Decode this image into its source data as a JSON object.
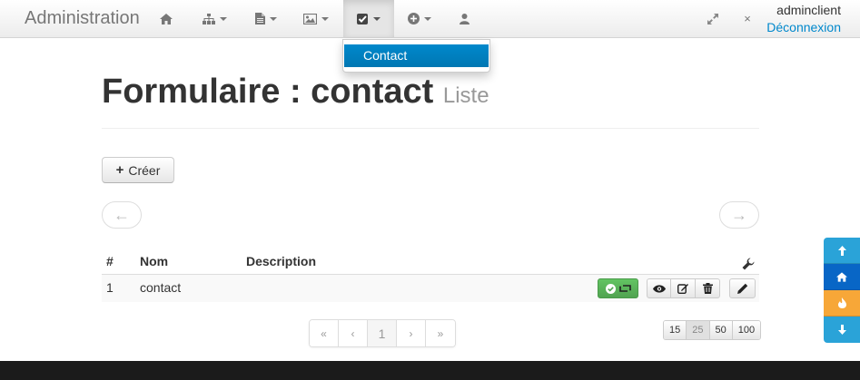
{
  "navbar": {
    "brand": "Administration",
    "items": [
      {
        "icon": "home-icon"
      },
      {
        "icon": "sitemap-icon",
        "dropdown": true
      },
      {
        "icon": "file-icon",
        "dropdown": true
      },
      {
        "icon": "picture-icon",
        "dropdown": true
      },
      {
        "icon": "check-icon",
        "dropdown": true,
        "active": true
      },
      {
        "icon": "plus-circle-icon",
        "dropdown": true
      },
      {
        "icon": "user-icon"
      }
    ],
    "user_name": "adminclient",
    "logout_label": "Déconnexion"
  },
  "dropdown": {
    "items": [
      {
        "label": "Contact"
      }
    ]
  },
  "page": {
    "title": "Formulaire : contact",
    "subtitle": "Liste"
  },
  "actions": {
    "create_label": "Créer"
  },
  "pager": {
    "prev": "←",
    "next": "→"
  },
  "table": {
    "columns": [
      "#",
      "Nom",
      "Description"
    ],
    "rows": [
      {
        "id": "1",
        "name": "contact",
        "description": ""
      }
    ]
  },
  "pagination": {
    "first": "«",
    "prev": "‹",
    "current": "1",
    "next": "›",
    "last": "»"
  },
  "per_page": {
    "options": [
      "15",
      "25",
      "50",
      "100"
    ],
    "selected": "25"
  },
  "colors": {
    "primary": "#0088cc",
    "success": "#51a351",
    "side_blue": "#2aa3d8",
    "side_orange": "#f7a738"
  }
}
